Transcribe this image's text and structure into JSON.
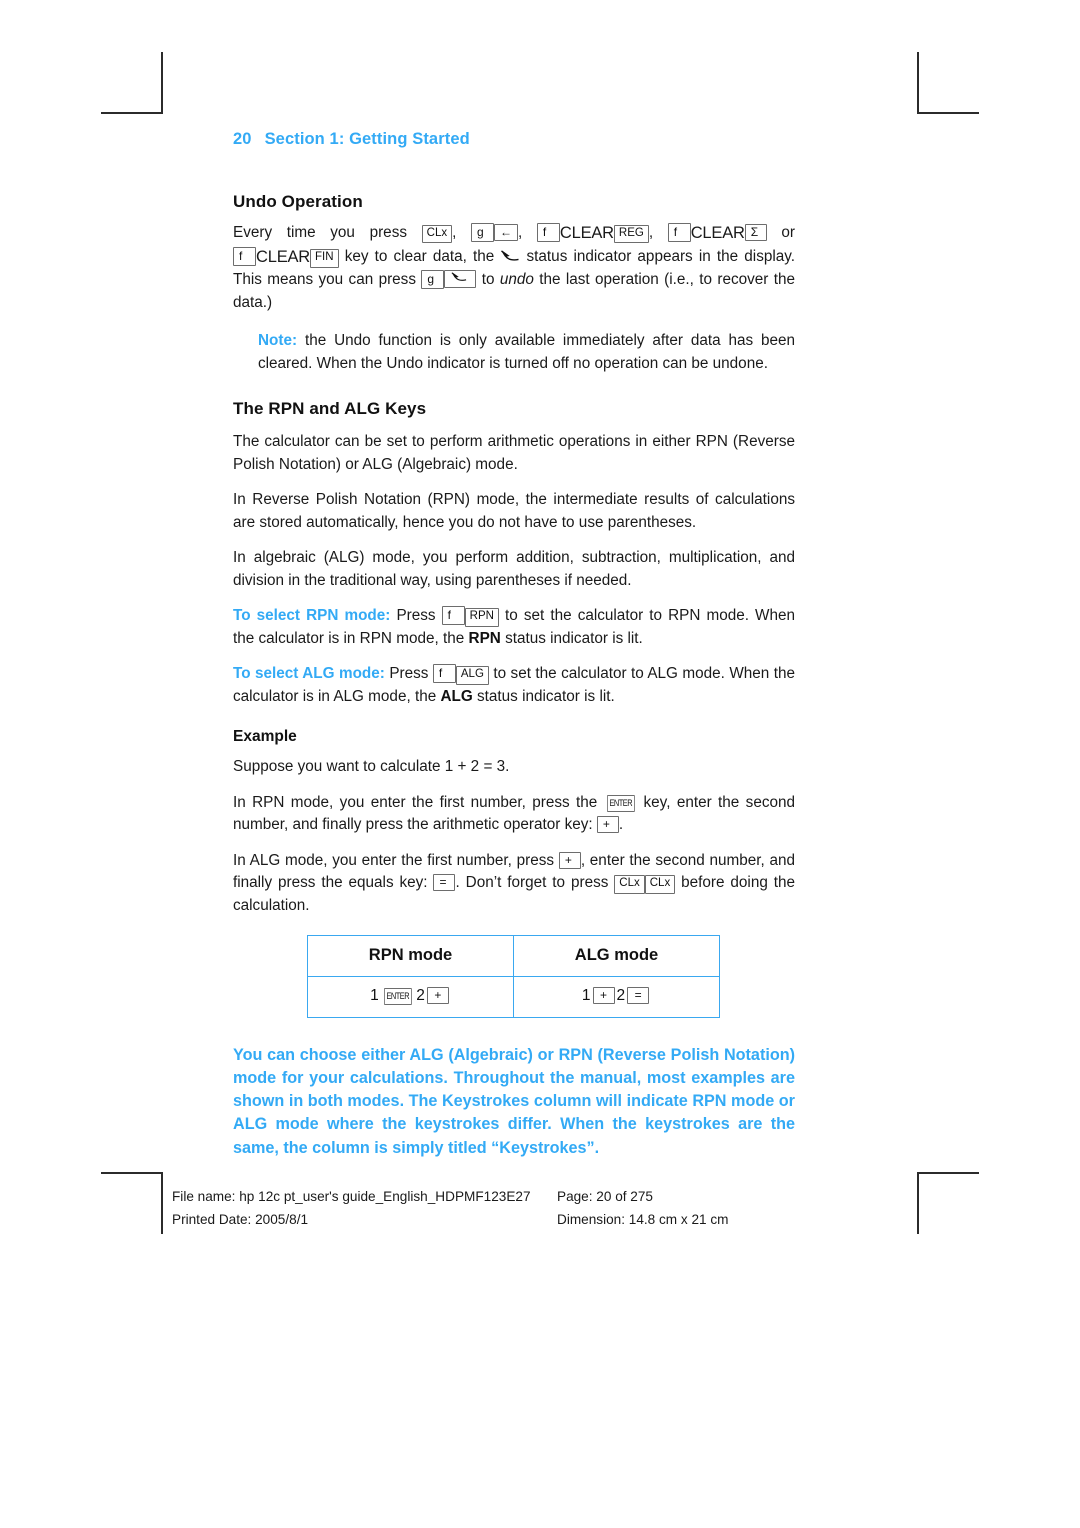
{
  "header": {
    "page_number": "20",
    "section_title": "Section 1: Getting Started"
  },
  "sections": {
    "undo": {
      "heading": "Undo Operation",
      "para1_a": "Every time you press",
      "para1_b": ",",
      "para1_c": ",",
      "para1_d": ",",
      "para1_e": "or",
      "para1_f": "key to clear data, the",
      "para1_g": "status indicator appears in the display. This means you can press",
      "para1_h": "to",
      "para1_i": "undo",
      "para1_j": "the last operation (i.e., to recover the data.)",
      "note_label": "Note:",
      "note_text": "the Undo function is only available immediately after data has been cleared. When the Undo indicator is turned off no operation can be undone."
    },
    "rpnalg": {
      "heading": "The RPN and ALG Keys",
      "para1": "The calculator can be set to perform arithmetic operations in either RPN (Reverse Polish Notation) or ALG (Algebraic) mode.",
      "para2": "In Reverse Polish Notation (RPN) mode, the intermediate results of calculations are stored automatically, hence you do not have to use parentheses.",
      "para3": "In algebraic (ALG) mode, you perform addition, subtraction, multiplication, and division in the traditional way, using parentheses if needed.",
      "rpn_lead": "To select RPN mode:",
      "rpn_a": "Press",
      "rpn_b": "to set the calculator to RPN mode. When the calculator is in RPN mode, the",
      "rpn_ind": "RPN",
      "rpn_c": "status indicator is lit.",
      "alg_lead": "To select ALG mode:",
      "alg_a": "Press",
      "alg_b": "to set the calculator to ALG mode. When the calculator is in ALG mode, the",
      "alg_ind": "ALG",
      "alg_c": "status indicator is lit."
    },
    "example": {
      "heading": "Example",
      "para1": "Suppose you want to calculate 1 + 2 = 3.",
      "para2_a": "In RPN mode, you enter the first number, press the",
      "para2_b": "key, enter the second number, and finally press the arithmetic operator key:",
      "para2_c": ".",
      "para3_a": "In ALG mode, you enter the first number, press",
      "para3_b": ", enter the second number, and finally press the equals key:",
      "para3_c": ". Don’t forget to press",
      "para3_d": "before doing the calculation."
    }
  },
  "mode_table": {
    "headers": [
      "RPN mode",
      "ALG mode"
    ],
    "rpn_row": [
      "1",
      "2"
    ],
    "alg_row": [
      "1",
      "2"
    ]
  },
  "callout": "You can choose either ALG (Algebraic) or RPN (Reverse Polish Notation) mode for your calculations. Throughout the manual, most examples are shown in both modes. The Keystrokes column will indicate RPN mode or ALG mode where the keystrokes differ. When the keystrokes are the same, the column is simply titled “Keystrokes”.",
  "keys": {
    "clx": "CLx",
    "g": "g",
    "f": "f",
    "backspace": "←",
    "clear": "CLEAR",
    "reg": "REG",
    "sigma": "Σ",
    "fin": "FIN",
    "rpn": "RPN",
    "alg": "ALG",
    "enter": "ENTER",
    "plus": "+",
    "equals": "=",
    "undo_indicator": "undo-arrow"
  },
  "footer": {
    "file_name": "File name: hp 12c pt_user's guide_English_HDPMF123E27",
    "page": "Page: 20 of 275",
    "printed_date": "Printed Date: 2005/8/1",
    "dimension": "Dimension: 14.8 cm x 21 cm"
  },
  "colors": {
    "accent_blue": "#33aaf5",
    "table_border": "#3aa8f0",
    "text": "#1a1a1a"
  }
}
